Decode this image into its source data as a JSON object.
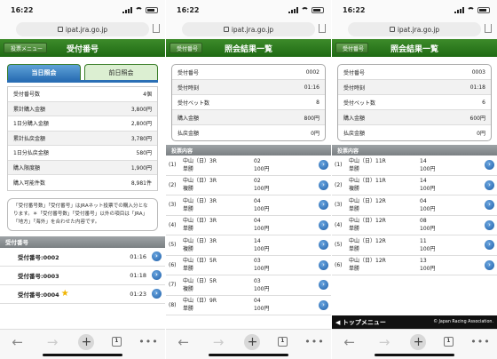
{
  "panels": [
    {
      "status": {
        "time": "16:22"
      },
      "url": "ipat.jra.go.jp",
      "nav": {
        "back": "投票メニュー",
        "title": "受付番号"
      },
      "tabs": [
        {
          "label": "当日照会"
        },
        {
          "label": "前日照会"
        }
      ],
      "summary": [
        {
          "label": "受付番号数",
          "value": "4個"
        },
        {
          "label": "累計購入金額",
          "value": "3,800円"
        },
        {
          "label": "1日分購入金額",
          "value": "2,800円"
        },
        {
          "label": "累計払戻金額",
          "value": "3,780円"
        },
        {
          "label": "1日分払戻金額",
          "value": "580円"
        },
        {
          "label": "購入限度額",
          "value": "1,900円"
        },
        {
          "label": "購入可能件数",
          "value": "8,981件"
        }
      ],
      "note": "「受付番号数」「受付番号」はJRAネット投票での購入分となります。＊「受付番号数」「受付番号」以外の項目は「JRA」「地方」「海外」を合わせた内容です。",
      "section_title": "受付番号",
      "tickets": [
        {
          "label": "受付番号:0002",
          "time": "01:16",
          "star": ""
        },
        {
          "label": "受付番号:0003",
          "time": "01:18",
          "star": ""
        },
        {
          "label": "受付番号:0004",
          "time": "01:23",
          "star": "★"
        }
      ]
    },
    {
      "status": {
        "time": "16:22"
      },
      "url": "ipat.jra.go.jp",
      "nav": {
        "back": "受付番号",
        "title": "照会結果一覧"
      },
      "info": [
        {
          "label": "受付番号",
          "value": "0002"
        },
        {
          "label": "受付時刻",
          "value": "01:16"
        },
        {
          "label": "受付ベット数",
          "value": "8"
        },
        {
          "label": "購入金額",
          "value": "800円"
        },
        {
          "label": "払戻金額",
          "value": "0円"
        }
      ],
      "vote_title": "投票内容",
      "votes": [
        {
          "no": "(1)",
          "race": "中山（日）3R",
          "type": "単勝",
          "num": "02",
          "amt": "100円"
        },
        {
          "no": "(2)",
          "race": "中山（日）3R",
          "type": "複勝",
          "num": "02",
          "amt": "100円"
        },
        {
          "no": "(3)",
          "race": "中山（日）3R",
          "type": "単勝",
          "num": "04",
          "amt": "100円"
        },
        {
          "no": "(4)",
          "race": "中山（日）3R",
          "type": "単勝",
          "num": "04",
          "amt": "100円"
        },
        {
          "no": "(5)",
          "race": "中山（日）3R",
          "type": "複勝",
          "num": "14",
          "amt": "100円"
        },
        {
          "no": "(6)",
          "race": "中山（日）5R",
          "type": "単勝",
          "num": "03",
          "amt": "100円"
        },
        {
          "no": "(7)",
          "race": "中山（日）5R",
          "type": "複勝",
          "num": "03",
          "amt": "100円"
        },
        {
          "no": "(8)",
          "race": "中山（日）9R",
          "type": "単勝",
          "num": "04",
          "amt": "100円"
        }
      ]
    },
    {
      "status": {
        "time": "16:22"
      },
      "url": "ipat.jra.go.jp",
      "nav": {
        "back": "受付番号",
        "title": "照会結果一覧"
      },
      "info": [
        {
          "label": "受付番号",
          "value": "0003"
        },
        {
          "label": "受付時刻",
          "value": "01:18"
        },
        {
          "label": "受付ベット数",
          "value": "6"
        },
        {
          "label": "購入金額",
          "value": "600円"
        },
        {
          "label": "払戻金額",
          "value": "0円"
        }
      ],
      "vote_title": "投票内容",
      "votes": [
        {
          "no": "(1)",
          "race": "中山（日）11R",
          "type": "単勝",
          "num": "14",
          "amt": "100円"
        },
        {
          "no": "(2)",
          "race": "中山（日）11R",
          "type": "複勝",
          "num": "14",
          "amt": "100円"
        },
        {
          "no": "(3)",
          "race": "中山（日）12R",
          "type": "単勝",
          "num": "04",
          "amt": "100円"
        },
        {
          "no": "(4)",
          "race": "中山（日）12R",
          "type": "単勝",
          "num": "08",
          "amt": "100円"
        },
        {
          "no": "(5)",
          "race": "中山（日）12R",
          "type": "単勝",
          "num": "11",
          "amt": "100円"
        },
        {
          "no": "(6)",
          "race": "中山（日）12R",
          "type": "単勝",
          "num": "13",
          "amt": "100円"
        }
      ],
      "footer": {
        "menu": "◀ トップメニュー",
        "copyright": "© Japan Racing Association."
      }
    }
  ],
  "toolbar": {
    "tab_count": "1",
    "icons": [
      "back-arrow-icon",
      "forward-arrow-icon",
      "plus-icon",
      "tabs-icon",
      "more-icon"
    ]
  },
  "colors": {
    "header_green": "#2a7a1c",
    "tab_blue": "#2b6fb5",
    "section_gray": "#8c9194",
    "arrow_blue": "#1f5fa8"
  }
}
